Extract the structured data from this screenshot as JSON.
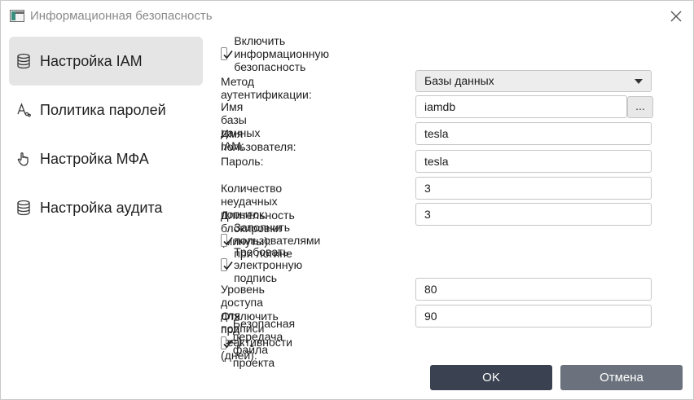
{
  "window": {
    "title": "Информационная безопасность"
  },
  "sidebar": {
    "items": [
      {
        "label": "Настройка IAM",
        "icon": "database-icon",
        "active": true
      },
      {
        "label": "Политика паролей",
        "icon": "password-policy-icon",
        "active": false
      },
      {
        "label": "Настройка МФА",
        "icon": "hand-pointer-icon",
        "active": false
      },
      {
        "label": "Настройка аудита",
        "icon": "database-icon",
        "active": false
      }
    ]
  },
  "form": {
    "enable_security": {
      "label": "Включить информационную безопасность",
      "checked": true
    },
    "auth_method": {
      "label": "Метод аутентификации:",
      "value": "Базы данных"
    },
    "iam_db_name": {
      "label": "Имя базы данных IAM:",
      "value": "iamdb",
      "browse_label": "..."
    },
    "username": {
      "label": "Имя пользователя:",
      "value": "tesla"
    },
    "password": {
      "label": "Пароль:",
      "value": "tesla"
    },
    "failed_attempts": {
      "label": "Количество неудачных попыток:",
      "value": "3"
    },
    "lock_duration": {
      "label": "Длительность блокировки (минуты):",
      "value": "3"
    },
    "fill_users_on_login": {
      "label": "Заполнить пользователями при логине",
      "checked": true
    },
    "require_esign": {
      "label": "Требовать электронную подпись",
      "checked": true
    },
    "sign_access_level": {
      "label": "Уровень доступа для подписи (>=):",
      "value": "80"
    },
    "inactivity_disable": {
      "label": "Отключить при неактивности (дней):",
      "value": "90"
    },
    "secure_project_transfer": {
      "label": "Безопасная передача файла проекта",
      "checked": true
    }
  },
  "buttons": {
    "ok": "OK",
    "cancel": "Отмена"
  },
  "colors": {
    "ok_button": "#3a4150",
    "cancel_button": "#6c727d",
    "active_sidebar": "#e5e5e5"
  }
}
